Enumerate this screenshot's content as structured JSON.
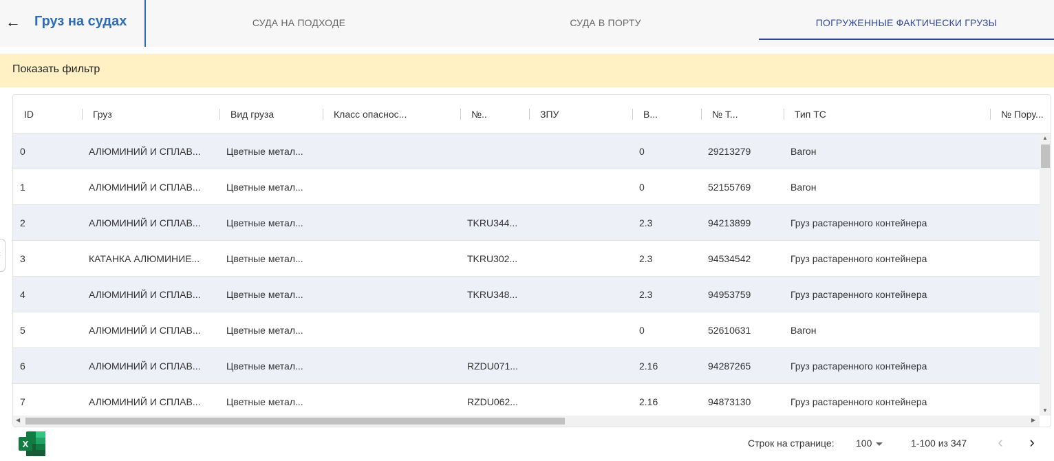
{
  "header": {
    "back_icon": "arrow-left-icon",
    "title": "Груз на судах",
    "tabs": [
      {
        "label": "СУДА НА ПОДХОДЕ"
      },
      {
        "label": "СУДА В ПОРТУ"
      },
      {
        "label": "ПОГРУЖЕННЫЕ ФАКТИЧЕСКИ ГРУЗЫ"
      }
    ],
    "active_tab": 2
  },
  "filter": {
    "label": "Показать фильтр"
  },
  "colors": {
    "accent": "#2c6cb8",
    "tab_active": "#3346a0",
    "filter_bg": "#fff1c4",
    "row_alt": "#edf0f7"
  },
  "grid": {
    "columns": [
      "ID",
      "Груз",
      "Вид груза",
      "Класс опаснос...",
      "№..",
      "ЗПУ",
      "В...",
      "№ Т...",
      "Тип ТС",
      "№ Пору..."
    ],
    "rows": [
      {
        "id": "0",
        "cargo": "АЛЮМИНИЙ И СПЛАВ...",
        "kind": "Цветные метал...",
        "hazard": "",
        "num": "",
        "zpu": "",
        "v": "0",
        "nt": "29213279",
        "type": "Вагон",
        "order": ""
      },
      {
        "id": "1",
        "cargo": "АЛЮМИНИЙ И СПЛАВ...",
        "kind": "Цветные метал...",
        "hazard": "",
        "num": "",
        "zpu": "",
        "v": "0",
        "nt": "52155769",
        "type": "Вагон",
        "order": ""
      },
      {
        "id": "2",
        "cargo": "АЛЮМИНИЙ И СПЛАВ...",
        "kind": "Цветные метал...",
        "hazard": "",
        "num": "TKRU344...",
        "zpu": "",
        "v": "2.3",
        "nt": "94213899",
        "type": "Груз растаренного контейнера",
        "order": ""
      },
      {
        "id": "3",
        "cargo": "КАТАНКА АЛЮМИНИЕ...",
        "kind": "Цветные метал...",
        "hazard": "",
        "num": "TKRU302...",
        "zpu": "",
        "v": "2.3",
        "nt": "94534542",
        "type": "Груз растаренного контейнера",
        "order": ""
      },
      {
        "id": "4",
        "cargo": "АЛЮМИНИЙ И СПЛАВ...",
        "kind": "Цветные метал...",
        "hazard": "",
        "num": "TKRU348...",
        "zpu": "",
        "v": "2.3",
        "nt": "94953759",
        "type": "Груз растаренного контейнера",
        "order": ""
      },
      {
        "id": "5",
        "cargo": "АЛЮМИНИЙ И СПЛАВ...",
        "kind": "Цветные метал...",
        "hazard": "",
        "num": "",
        "zpu": "",
        "v": "0",
        "nt": "52610631",
        "type": "Вагон",
        "order": ""
      },
      {
        "id": "6",
        "cargo": "АЛЮМИНИЙ И СПЛАВ...",
        "kind": "Цветные метал...",
        "hazard": "",
        "num": "RZDU071...",
        "zpu": "",
        "v": "2.16",
        "nt": "94287265",
        "type": "Груз растаренного контейнера",
        "order": ""
      },
      {
        "id": "7",
        "cargo": "АЛЮМИНИЙ И СПЛАВ...",
        "kind": "Цветные метал...",
        "hazard": "",
        "num": "RZDU062...",
        "zpu": "",
        "v": "2.16",
        "nt": "94873130",
        "type": "Груз растаренного контейнера",
        "order": ""
      }
    ]
  },
  "footer": {
    "excel_icon": "excel-icon",
    "rows_per_page_label": "Строк на странице:",
    "rows_per_page_value": "100",
    "range": "1-100 из 347",
    "prev_icon": "chevron-left-icon",
    "next_icon": "chevron-right-icon"
  }
}
